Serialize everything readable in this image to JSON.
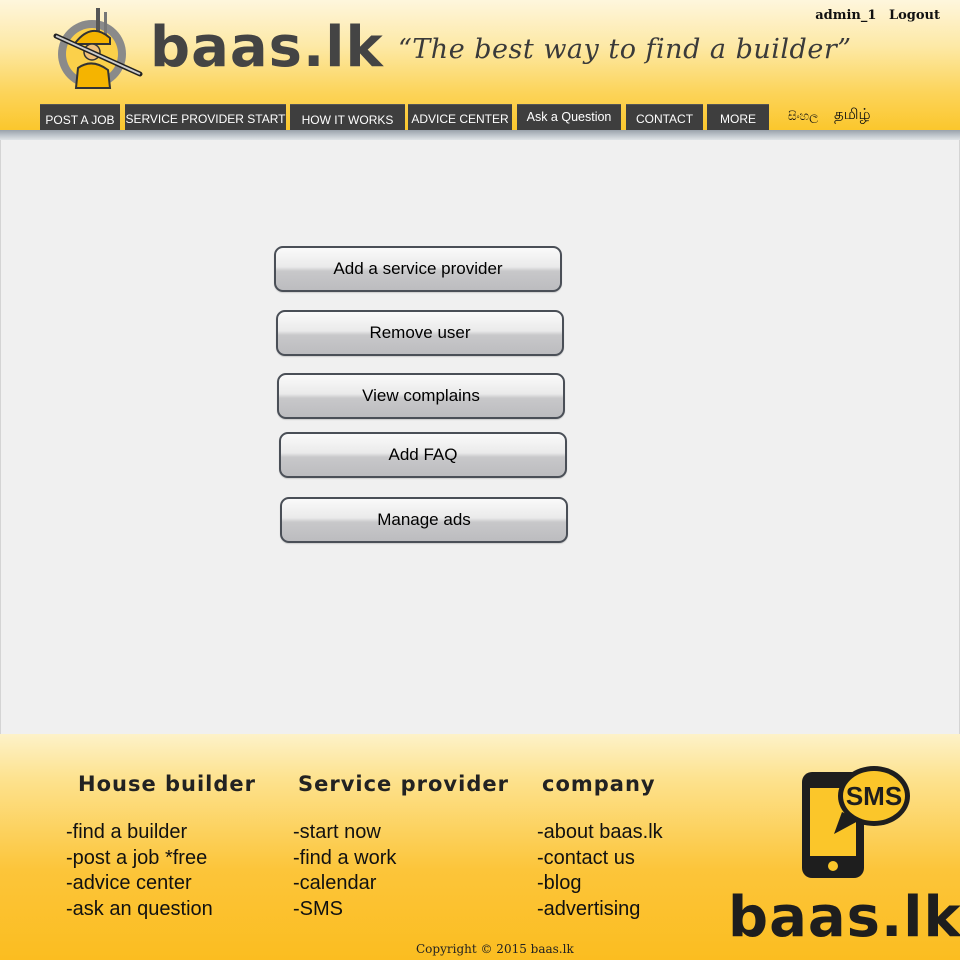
{
  "header": {
    "logo_text": "baas.lk",
    "tagline": "“The best way to find a builder”",
    "username": "admin_1",
    "logout_label": "Logout"
  },
  "nav": {
    "items": [
      {
        "label": "POST A JOB"
      },
      {
        "label": "SERVICE PROVIDER START"
      },
      {
        "label": "HOW IT WORKS"
      },
      {
        "label": "ADVICE CENTER"
      },
      {
        "label": "Ask a Question"
      },
      {
        "label": "CONTACT"
      },
      {
        "label": "MORE"
      }
    ],
    "languages": [
      "සිංහල",
      "தமிழ்"
    ]
  },
  "actions": [
    {
      "label": "Add a service provider"
    },
    {
      "label": "Remove user"
    },
    {
      "label": "View complains"
    },
    {
      "label": "Add FAQ"
    },
    {
      "label": "Manage ads"
    }
  ],
  "footer": {
    "columns": [
      {
        "title": "House builder",
        "links": [
          "-find a builder",
          "-post a job *free",
          "-advice center",
          "-ask an question"
        ]
      },
      {
        "title": "Service provider",
        "links": [
          "-start now",
          "-find a work",
          "-calendar",
          "-SMS"
        ]
      },
      {
        "title": "company",
        "links": [
          "-about baas.lk",
          "-contact us",
          "-blog",
          "-advertising"
        ]
      }
    ],
    "sms_label": "SMS",
    "logo_text": "baas.lk",
    "copyright": "Copyright © 2015 baas.lk"
  },
  "colors": {
    "brand_yellow": "#fbc62a",
    "nav_bg": "#3e3e3e",
    "button_border": "#4a4f57"
  }
}
